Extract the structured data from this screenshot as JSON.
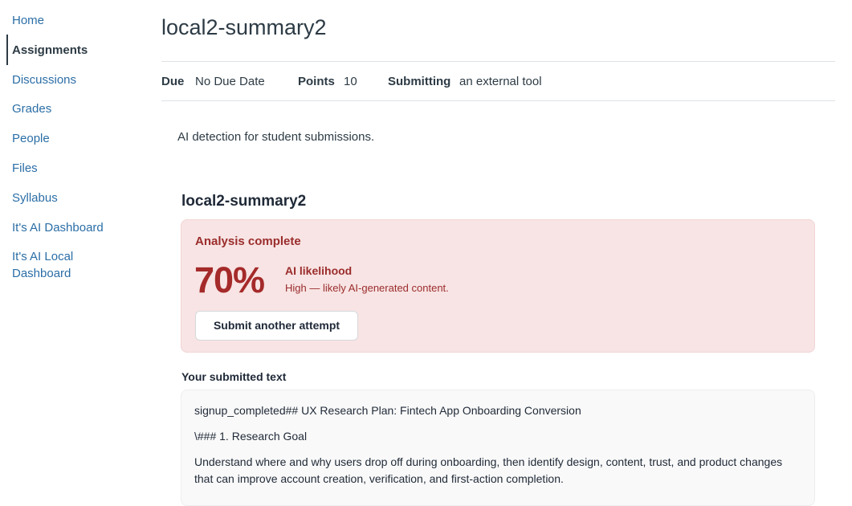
{
  "sidebar": {
    "items": [
      {
        "label": "Home",
        "active": false
      },
      {
        "label": "Assignments",
        "active": true
      },
      {
        "label": "Discussions",
        "active": false
      },
      {
        "label": "Grades",
        "active": false
      },
      {
        "label": "People",
        "active": false
      },
      {
        "label": "Files",
        "active": false
      },
      {
        "label": "Syllabus",
        "active": false
      },
      {
        "label": "It's AI Dashboard",
        "active": false
      },
      {
        "label": "It's AI Local Dashboard",
        "active": false
      }
    ]
  },
  "assignment": {
    "title": "local2-summary2",
    "meta": {
      "due_label": "Due",
      "due_value": "No Due Date",
      "points_label": "Points",
      "points_value": "10",
      "submitting_label": "Submitting",
      "submitting_value": "an external tool"
    },
    "description": "AI detection for student submissions."
  },
  "tool": {
    "title": "local2-summary2",
    "result": {
      "status": "Analysis complete",
      "percent": "70%",
      "likelihood_label": "AI likelihood",
      "likelihood_desc": "High — likely AI-generated content.",
      "button_label": "Submit another attempt"
    },
    "submitted_label": "Your submitted text",
    "submitted_paragraphs": [
      "signup_completed## UX Research Plan: Fintech App Onboarding Conversion",
      "\\### 1. Research Goal",
      "Understand where and why users drop off during onboarding, then identify design, content, trust, and product changes that can improve account creation, verification, and first-action completion."
    ]
  },
  "colors": {
    "link": "#2b6ea6",
    "text": "#2d3b45",
    "alert_bg": "#f8e4e4",
    "alert_text": "#9b2c2c",
    "percent": "#a52a2a"
  }
}
